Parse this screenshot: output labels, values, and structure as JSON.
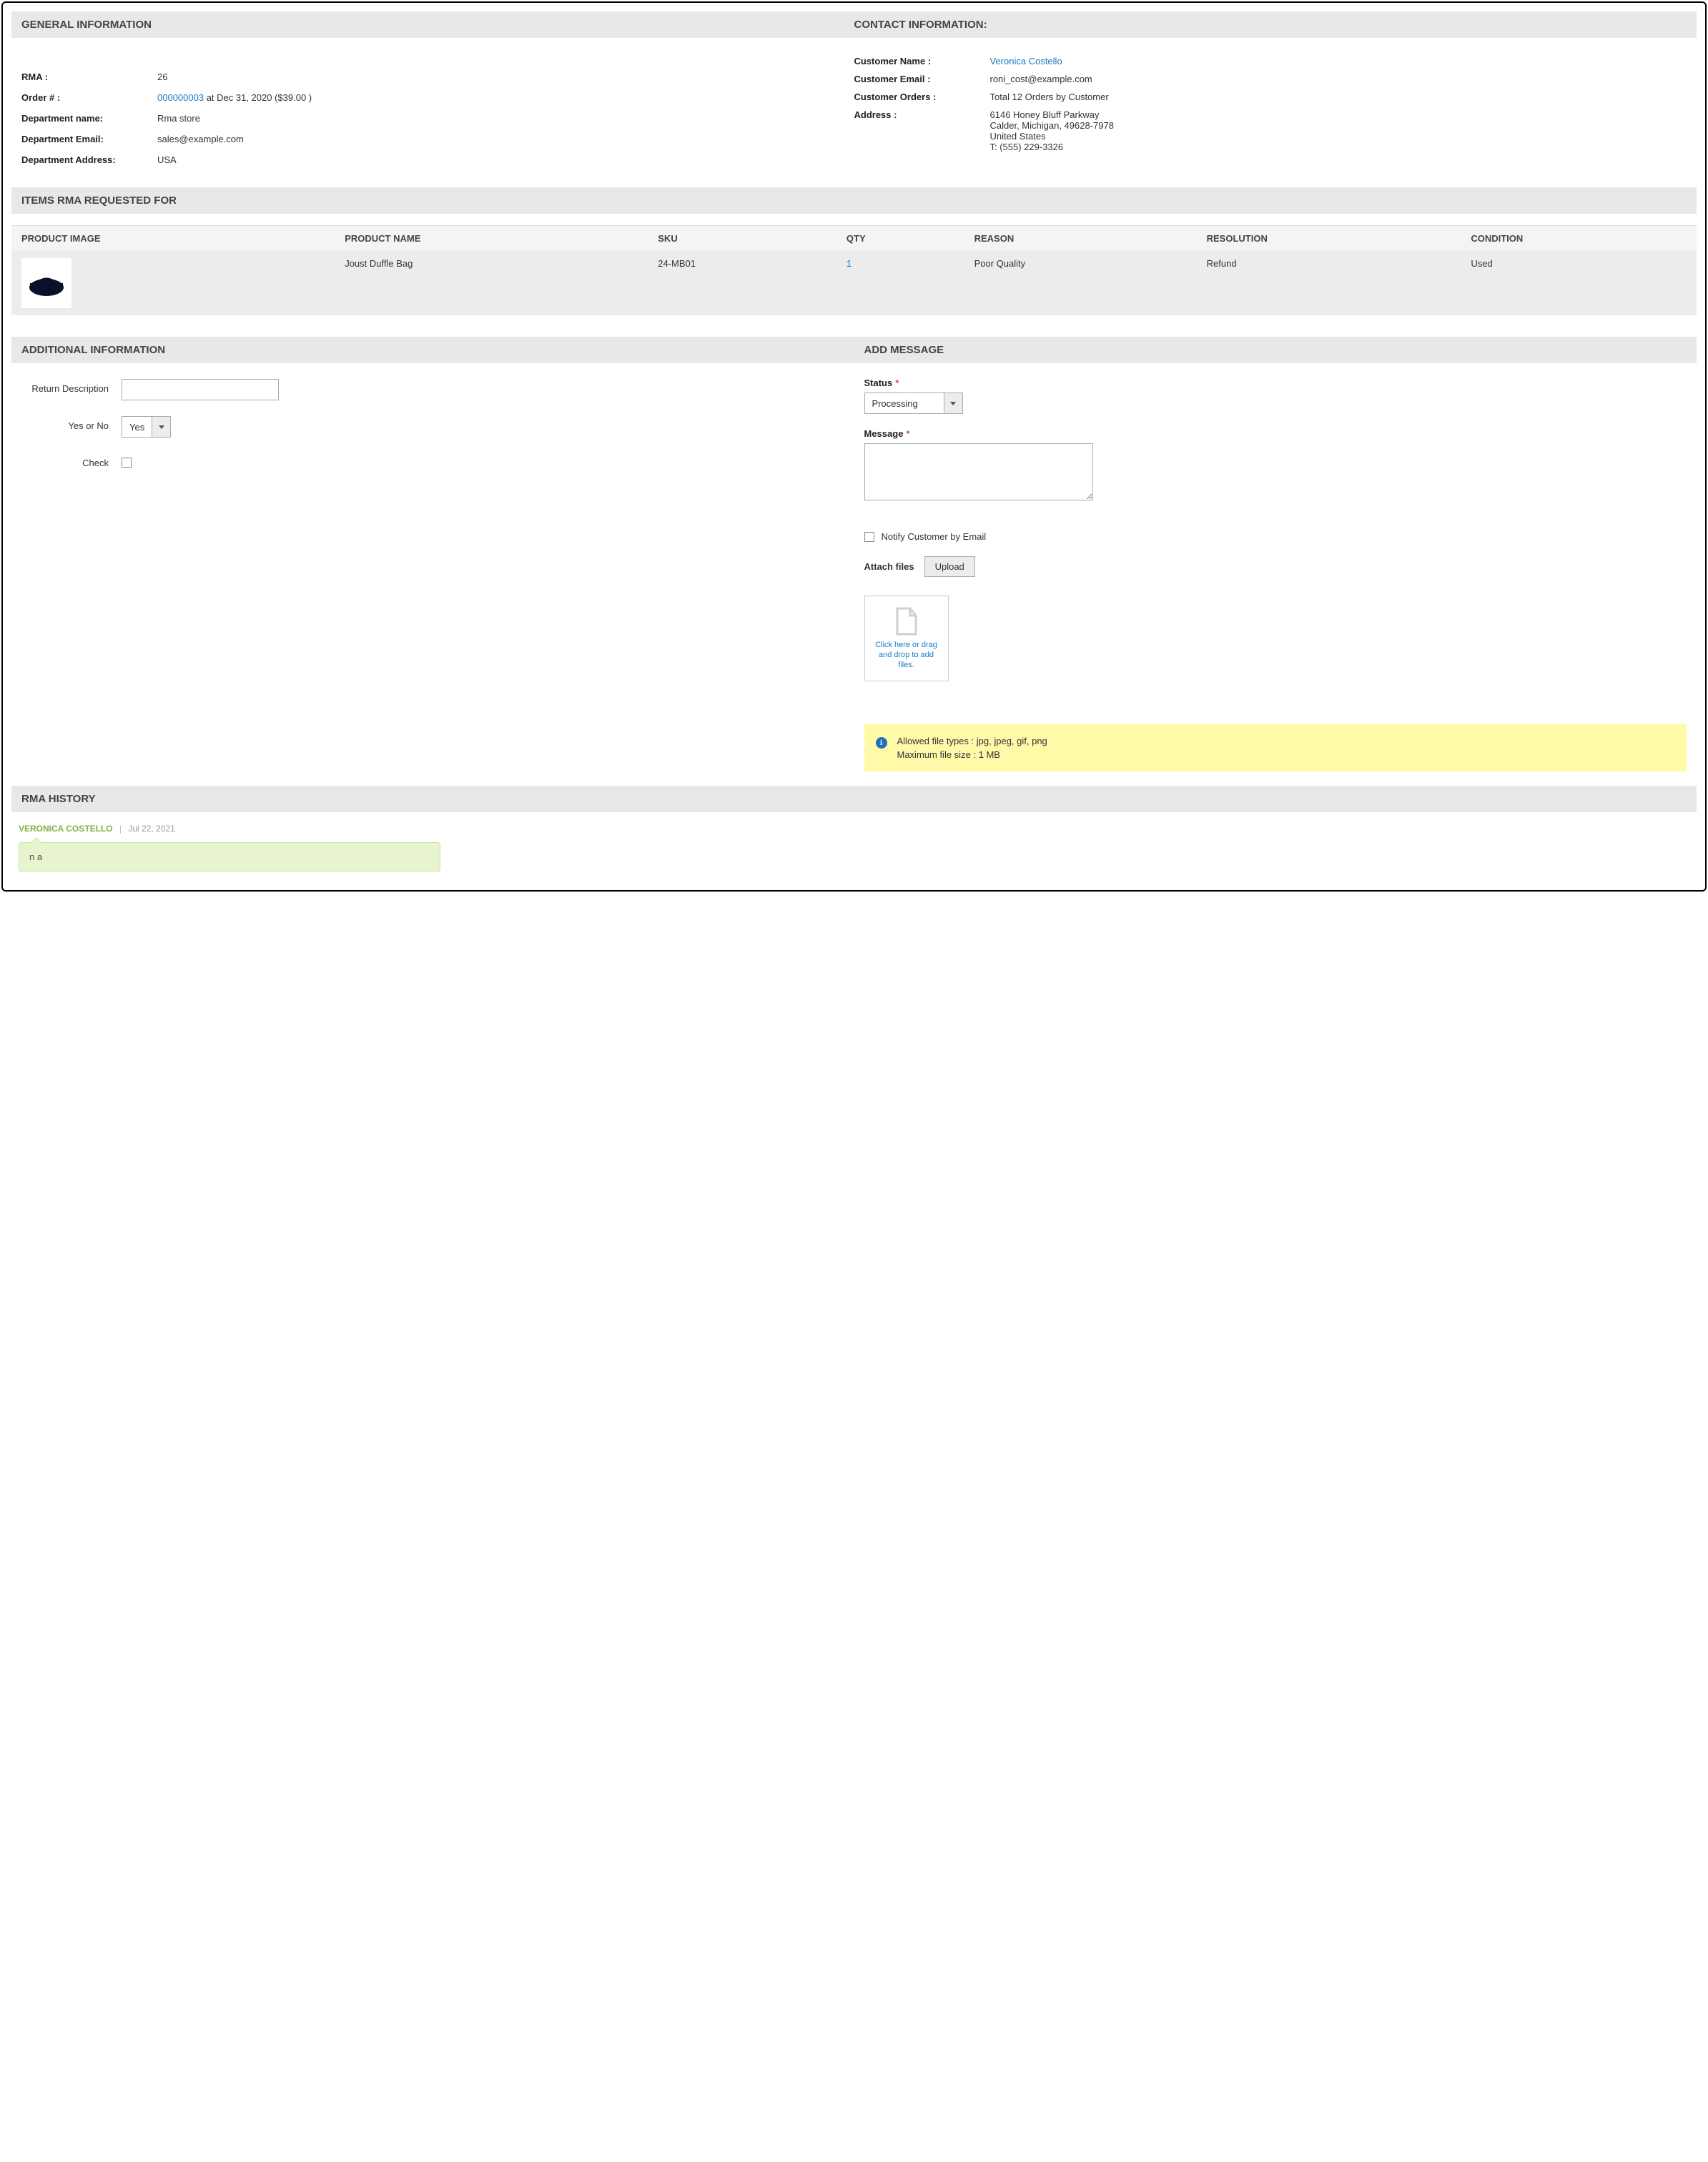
{
  "sections": {
    "general": "GENERAL INFORMATION",
    "contact": "CONTACT INFORMATION:",
    "items": "ITEMS RMA REQUESTED FOR",
    "additional": "ADDITIONAL INFORMATION",
    "add_message": "ADD MESSAGE",
    "history": "RMA HISTORY"
  },
  "general": {
    "rma_label": "RMA :",
    "rma_value": "26",
    "order_label": "Order # :",
    "order_link": "000000003",
    "order_suffix": " at Dec 31, 2020 ($39.00 )",
    "dept_name_label": "Department name:",
    "dept_name_value": "Rma store",
    "dept_email_label": "Department Email:",
    "dept_email_value": "sales@example.com",
    "dept_addr_label": "Department Address:",
    "dept_addr_value": "USA"
  },
  "contact": {
    "name_label": "Customer Name :",
    "name_value": "Veronica Costello",
    "email_label": "Customer Email :",
    "email_value": "roni_cost@example.com",
    "orders_label": "Customer Orders :",
    "orders_value": "Total 12 Orders by Customer",
    "addr_label": "Address :",
    "addr_line1": "6146 Honey Bluff Parkway",
    "addr_line2": "Calder, Michigan, 49628-7978",
    "addr_line3": "United States",
    "addr_line4": "T: (555) 229-3326"
  },
  "items_table": {
    "headers": {
      "image": "PRODUCT IMAGE",
      "name": "PRODUCT NAME",
      "sku": "SKU",
      "qty": "QTY",
      "reason": "REASON",
      "resolution": "RESOLUTION",
      "condition": "CONDITION"
    },
    "rows": [
      {
        "name": "Joust Duffle Bag",
        "sku": "24-MB01",
        "qty": "1",
        "reason": "Poor Quality",
        "resolution": "Refund",
        "condition": "Used"
      }
    ]
  },
  "additional": {
    "return_desc_label": "Return Description",
    "return_desc_value": "",
    "yesno_label": "Yes or No",
    "yesno_value": "Yes",
    "check_label": "Check"
  },
  "message": {
    "status_label": "Status",
    "status_value": "Processing",
    "message_label": "Message",
    "message_value": "",
    "notify_label": "Notify Customer by Email",
    "attach_label": "Attach files",
    "upload_btn": "Upload",
    "dropzone_text": "Click here or drag and drop to add files.",
    "note_line1": "Allowed file types : jpg, jpeg, gif, png",
    "note_line2": "Maximum file size : 1 MB"
  },
  "history": {
    "author": "VERONICA COSTELLO",
    "date": "Jul 22, 2021",
    "body": "n a"
  }
}
